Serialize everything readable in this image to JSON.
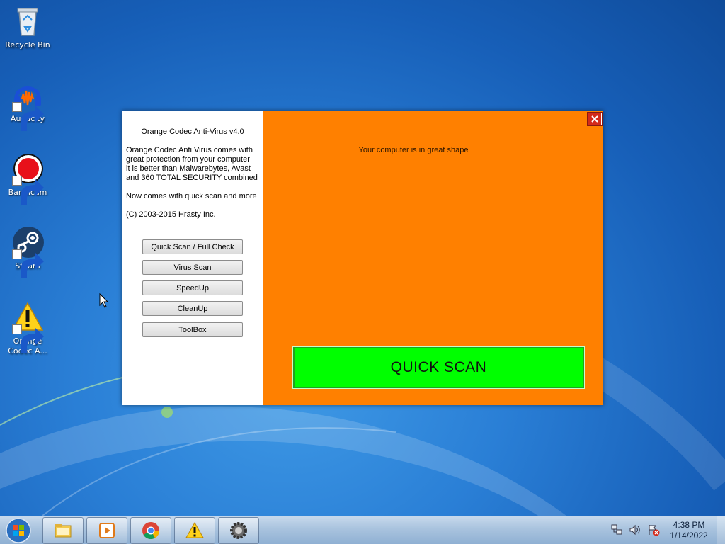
{
  "desktop": {
    "icons": [
      {
        "label": "Recycle Bin",
        "icon": "recycle-bin-icon"
      },
      {
        "label": "Audacity",
        "icon": "audacity-icon"
      },
      {
        "label": "Bandicam",
        "icon": "bandicam-icon"
      },
      {
        "label": "Steam",
        "icon": "steam-icon"
      },
      {
        "label": "Orange Codec A...",
        "icon": "warning-icon"
      }
    ]
  },
  "app": {
    "title": "Orange Codec Anti-Virus v4.0",
    "description": [
      "Orange Codec Anti Virus comes with",
      "great protection from your computer",
      "it is better than Malwarebytes, Avast",
      "and 360 TOTAL SECURITY combined"
    ],
    "tagline": "Now comes with quick scan and more",
    "copyright": "(C) 2003-2015 Hrasty Inc.",
    "buttons": [
      {
        "label": "Quick Scan / Full Check"
      },
      {
        "label": "Virus Scan"
      },
      {
        "label": "SpeedUp"
      },
      {
        "label": "CleanUp"
      },
      {
        "label": "ToolBox"
      }
    ],
    "status": "Your computer is in great shape",
    "quick_scan_label": "QUICK SCAN",
    "colors": {
      "panel": "#ff8000",
      "scan_button": "#00ff00",
      "close": "#d42a1a"
    }
  },
  "taskbar": {
    "pinned": [
      {
        "icon": "file-explorer-icon"
      },
      {
        "icon": "media-player-icon"
      },
      {
        "icon": "chrome-icon"
      },
      {
        "icon": "warning-icon"
      },
      {
        "icon": "gear-icon"
      }
    ],
    "tray": [
      {
        "icon": "network-icon"
      },
      {
        "icon": "volume-icon"
      },
      {
        "icon": "action-center-icon"
      }
    ],
    "clock": {
      "time": "4:38 PM",
      "date": "1/14/2022"
    }
  }
}
